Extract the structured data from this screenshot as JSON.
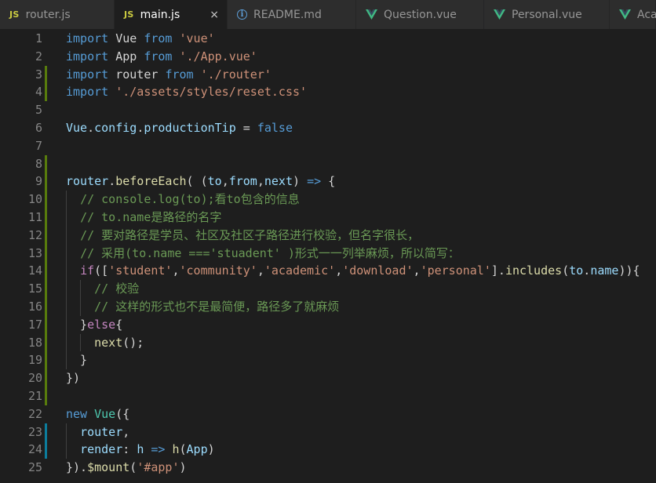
{
  "tabs": [
    {
      "label": "router.js",
      "icon": "js-icon",
      "active": false
    },
    {
      "label": "main.js",
      "icon": "js-icon",
      "active": true
    },
    {
      "label": "README.md",
      "icon": "info-icon",
      "active": false
    },
    {
      "label": "Question.vue",
      "icon": "vue-icon",
      "active": false
    },
    {
      "label": "Personal.vue",
      "icon": "vue-icon",
      "active": false
    },
    {
      "label": "Aca",
      "icon": "vue-icon",
      "active": false
    }
  ],
  "icons": {
    "js_text": "JS",
    "info_text": "i",
    "close": "×"
  },
  "colors": {
    "keyword": "#569cd6",
    "string": "#ce9178",
    "variable": "#9cdcfe",
    "function": "#dcdcaa",
    "comment": "#6a9955",
    "git_added": "#587c0c",
    "git_modified": "#0c7d9d",
    "vue_green": "#41b883"
  },
  "editor": {
    "lines": [
      {
        "n": "1",
        "git": "",
        "indent": 0,
        "tokens": [
          [
            "kw",
            "import"
          ],
          [
            "op",
            " Vue "
          ],
          [
            "kw",
            "from"
          ],
          [
            "op",
            " "
          ],
          [
            "str",
            "'vue'"
          ]
        ]
      },
      {
        "n": "2",
        "git": "",
        "indent": 0,
        "tokens": [
          [
            "kw",
            "import"
          ],
          [
            "op",
            " App "
          ],
          [
            "kw",
            "from"
          ],
          [
            "op",
            " "
          ],
          [
            "str",
            "'./App.vue'"
          ]
        ]
      },
      {
        "n": "3",
        "git": "added",
        "indent": 0,
        "tokens": [
          [
            "kw",
            "import"
          ],
          [
            "op",
            " router "
          ],
          [
            "kw",
            "from"
          ],
          [
            "op",
            " "
          ],
          [
            "str",
            "'./router'"
          ]
        ]
      },
      {
        "n": "4",
        "git": "added",
        "indent": 0,
        "tokens": [
          [
            "kw",
            "import"
          ],
          [
            "op",
            " "
          ],
          [
            "str",
            "'./assets/styles/reset.css'"
          ]
        ]
      },
      {
        "n": "5",
        "git": "",
        "indent": 0,
        "tokens": []
      },
      {
        "n": "6",
        "git": "",
        "indent": 0,
        "tokens": [
          [
            "var",
            "Vue"
          ],
          [
            "op",
            "."
          ],
          [
            "var",
            "config"
          ],
          [
            "op",
            "."
          ],
          [
            "var",
            "productionTip"
          ],
          [
            "op",
            " = "
          ],
          [
            "kw",
            "false"
          ]
        ]
      },
      {
        "n": "7",
        "git": "",
        "indent": 0,
        "tokens": []
      },
      {
        "n": "8",
        "git": "added",
        "indent": 0,
        "tokens": []
      },
      {
        "n": "9",
        "git": "added",
        "indent": 0,
        "tokens": [
          [
            "var",
            "router"
          ],
          [
            "op",
            "."
          ],
          [
            "fn",
            "beforeEach"
          ],
          [
            "op",
            "( ("
          ],
          [
            "var",
            "to"
          ],
          [
            "op",
            ","
          ],
          [
            "var",
            "from"
          ],
          [
            "op",
            ","
          ],
          [
            "var",
            "next"
          ],
          [
            "op",
            ") "
          ],
          [
            "kw",
            "=>"
          ],
          [
            "op",
            " {"
          ]
        ]
      },
      {
        "n": "10",
        "git": "added",
        "indent": 1,
        "tokens": [
          [
            "op",
            "  "
          ],
          [
            "cm",
            "// console.log(to);看to包含的信息"
          ]
        ]
      },
      {
        "n": "11",
        "git": "added",
        "indent": 1,
        "tokens": [
          [
            "op",
            "  "
          ],
          [
            "cm",
            "// to.name是路径的名字"
          ]
        ]
      },
      {
        "n": "12",
        "git": "added",
        "indent": 1,
        "tokens": [
          [
            "op",
            "  "
          ],
          [
            "cm",
            "// 要对路径是学员、社区及社区子路径进行校验，但名字很长，"
          ]
        ]
      },
      {
        "n": "13",
        "git": "added",
        "indent": 1,
        "tokens": [
          [
            "op",
            "  "
          ],
          [
            "cm",
            "// 采用(to.name ==='stuadent' )形式一一列举麻烦，所以简写："
          ]
        ]
      },
      {
        "n": "14",
        "git": "added",
        "indent": 1,
        "tokens": [
          [
            "op",
            "  "
          ],
          [
            "ctl",
            "if"
          ],
          [
            "op",
            "(["
          ],
          [
            "str",
            "'student'"
          ],
          [
            "op",
            ","
          ],
          [
            "str",
            "'community'"
          ],
          [
            "op",
            ","
          ],
          [
            "str",
            "'academic'"
          ],
          [
            "op",
            ","
          ],
          [
            "str",
            "'download'"
          ],
          [
            "op",
            ","
          ],
          [
            "str",
            "'personal'"
          ],
          [
            "op",
            "]."
          ],
          [
            "fn",
            "includes"
          ],
          [
            "op",
            "("
          ],
          [
            "var",
            "to"
          ],
          [
            "op",
            "."
          ],
          [
            "var",
            "name"
          ],
          [
            "op",
            ")){"
          ]
        ]
      },
      {
        "n": "15",
        "git": "added",
        "indent": 2,
        "tokens": [
          [
            "op",
            "    "
          ],
          [
            "cm",
            "// 校验"
          ]
        ]
      },
      {
        "n": "16",
        "git": "added",
        "indent": 2,
        "tokens": [
          [
            "op",
            "    "
          ],
          [
            "cm",
            "// 这样的形式也不是最简便，路径多了就麻烦"
          ]
        ]
      },
      {
        "n": "17",
        "git": "added",
        "indent": 1,
        "tokens": [
          [
            "op",
            "  }"
          ],
          [
            "ctl",
            "else"
          ],
          [
            "op",
            "{"
          ]
        ]
      },
      {
        "n": "18",
        "git": "added",
        "indent": 2,
        "tokens": [
          [
            "op",
            "    "
          ],
          [
            "fn",
            "next"
          ],
          [
            "op",
            "();"
          ]
        ]
      },
      {
        "n": "19",
        "git": "added",
        "indent": 1,
        "tokens": [
          [
            "op",
            "  }"
          ]
        ]
      },
      {
        "n": "20",
        "git": "added",
        "indent": 0,
        "tokens": [
          [
            "op",
            "})"
          ]
        ]
      },
      {
        "n": "21",
        "git": "added",
        "indent": 0,
        "tokens": []
      },
      {
        "n": "22",
        "git": "",
        "indent": 0,
        "tokens": [
          [
            "kw",
            "new"
          ],
          [
            "op",
            " "
          ],
          [
            "cls",
            "Vue"
          ],
          [
            "op",
            "({"
          ]
        ]
      },
      {
        "n": "23",
        "git": "modified",
        "indent": 1,
        "tokens": [
          [
            "op",
            "  "
          ],
          [
            "var",
            "router"
          ],
          [
            "op",
            ","
          ]
        ]
      },
      {
        "n": "24",
        "git": "modified",
        "indent": 1,
        "tokens": [
          [
            "op",
            "  "
          ],
          [
            "var",
            "render"
          ],
          [
            "op",
            ": "
          ],
          [
            "var",
            "h"
          ],
          [
            "op",
            " "
          ],
          [
            "kw",
            "=>"
          ],
          [
            "op",
            " "
          ],
          [
            "fn",
            "h"
          ],
          [
            "op",
            "("
          ],
          [
            "var",
            "App"
          ],
          [
            "op",
            ")"
          ]
        ]
      },
      {
        "n": "25",
        "git": "",
        "indent": 0,
        "tokens": [
          [
            "op",
            "})."
          ],
          [
            "fn",
            "$mount"
          ],
          [
            "op",
            "("
          ],
          [
            "str",
            "'#app'"
          ],
          [
            "op",
            ")"
          ]
        ]
      }
    ]
  }
}
